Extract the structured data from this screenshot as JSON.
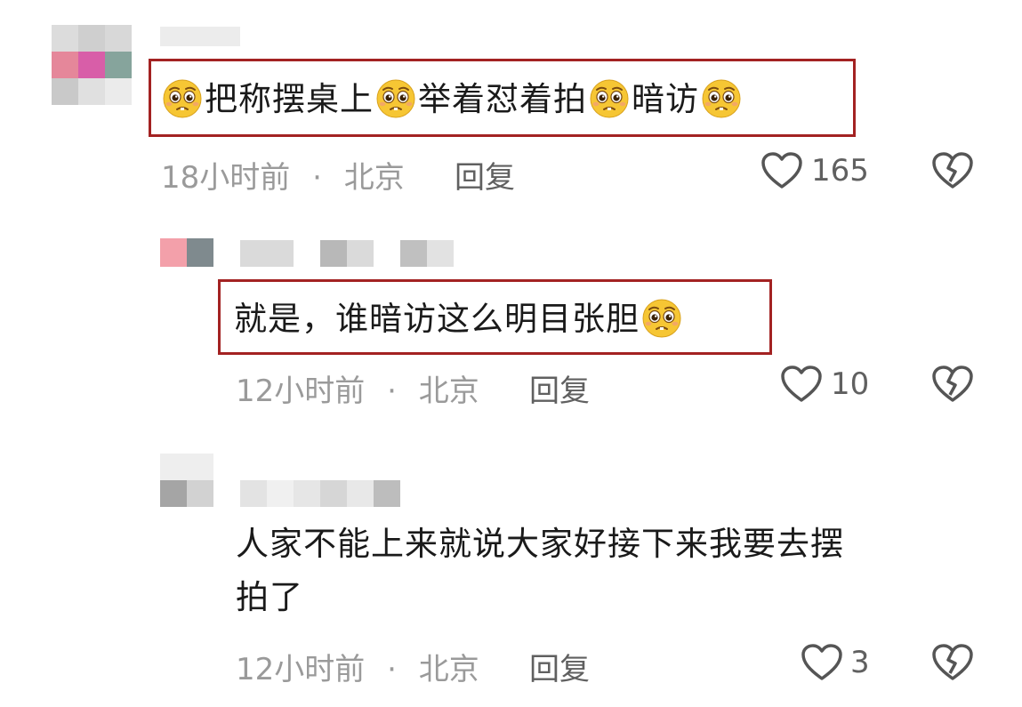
{
  "comments": [
    {
      "text_parts": [
        "把称摆桌上",
        "举着怼着拍",
        "暗访"
      ],
      "time": "18小时前",
      "location": "北京",
      "reply_label": "回复",
      "likes": "165"
    },
    {
      "text": "就是，谁暗访这么明目张胆",
      "time": "12小时前",
      "location": "北京",
      "reply_label": "回复",
      "likes": "10"
    },
    {
      "text_line1": "人家不能上来就说大家好接下来我要去摆",
      "text_line2": "拍了",
      "time": "12小时前",
      "location": "北京",
      "reply_label": "回复",
      "likes": "3"
    }
  ],
  "separator": "·",
  "icons": {
    "like": "heart-outline-icon",
    "dislike": "broken-heart-icon",
    "emoji": "pleading-face-emoji"
  },
  "colors": {
    "highlight_box": "#a32222",
    "meta_text": "#9a9a9a",
    "emoji_face": "#f6c634"
  }
}
